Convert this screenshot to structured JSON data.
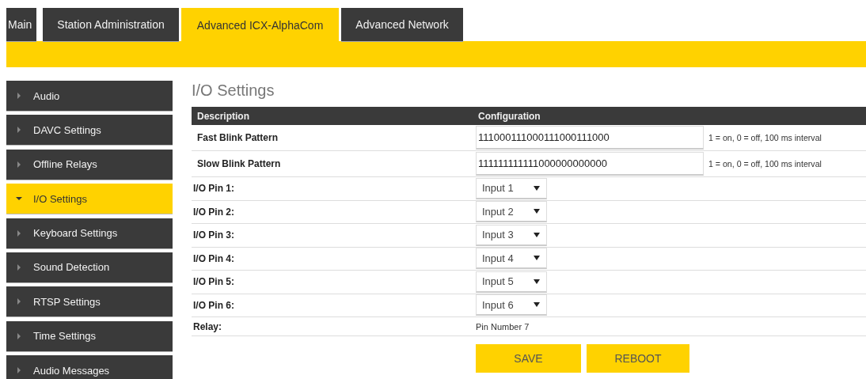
{
  "tabs": [
    {
      "label": "Main",
      "selected": false
    },
    {
      "label": "Station Administration",
      "selected": false
    },
    {
      "label": "Advanced ICX-AlphaCom",
      "selected": true
    },
    {
      "label": "Advanced Network",
      "selected": false
    }
  ],
  "sidebar": {
    "items": [
      {
        "label": "Audio",
        "selected": false
      },
      {
        "label": "DAVC Settings",
        "selected": false
      },
      {
        "label": "Offline Relays",
        "selected": false
      },
      {
        "label": "I/O Settings",
        "selected": true
      },
      {
        "label": "Keyboard Settings",
        "selected": false
      },
      {
        "label": "Sound Detection",
        "selected": false
      },
      {
        "label": "RTSP Settings",
        "selected": false
      },
      {
        "label": "Time Settings",
        "selected": false
      },
      {
        "label": "Audio Messages",
        "selected": false
      }
    ]
  },
  "content": {
    "title": "I/O Settings",
    "table": {
      "columns": [
        "Description",
        "Configuration"
      ],
      "rows": [
        {
          "kind": "text",
          "label": "Fast Blink Pattern",
          "value": "111000111000111000111000",
          "hint": "1 = on, 0 = off, 100 ms interval"
        },
        {
          "kind": "text",
          "label": "Slow Blink Pattern",
          "value": "111111111111000000000000",
          "hint": "1 = on, 0 = off, 100 ms interval"
        },
        {
          "kind": "select",
          "label": "I/O Pin 1:",
          "value": "Input 1"
        },
        {
          "kind": "select",
          "label": "I/O Pin 2:",
          "value": "Input 2"
        },
        {
          "kind": "select",
          "label": "I/O Pin 3:",
          "value": "Input 3"
        },
        {
          "kind": "select",
          "label": "I/O Pin 4:",
          "value": "Input 4"
        },
        {
          "kind": "select",
          "label": "I/O Pin 5:",
          "value": "Input 5"
        },
        {
          "kind": "select",
          "label": "I/O Pin 6:",
          "value": "Input 6"
        },
        {
          "kind": "static",
          "label": "Relay:",
          "value": "Pin Number 7"
        }
      ]
    },
    "buttons": [
      "SAVE",
      "REBOOT"
    ]
  }
}
